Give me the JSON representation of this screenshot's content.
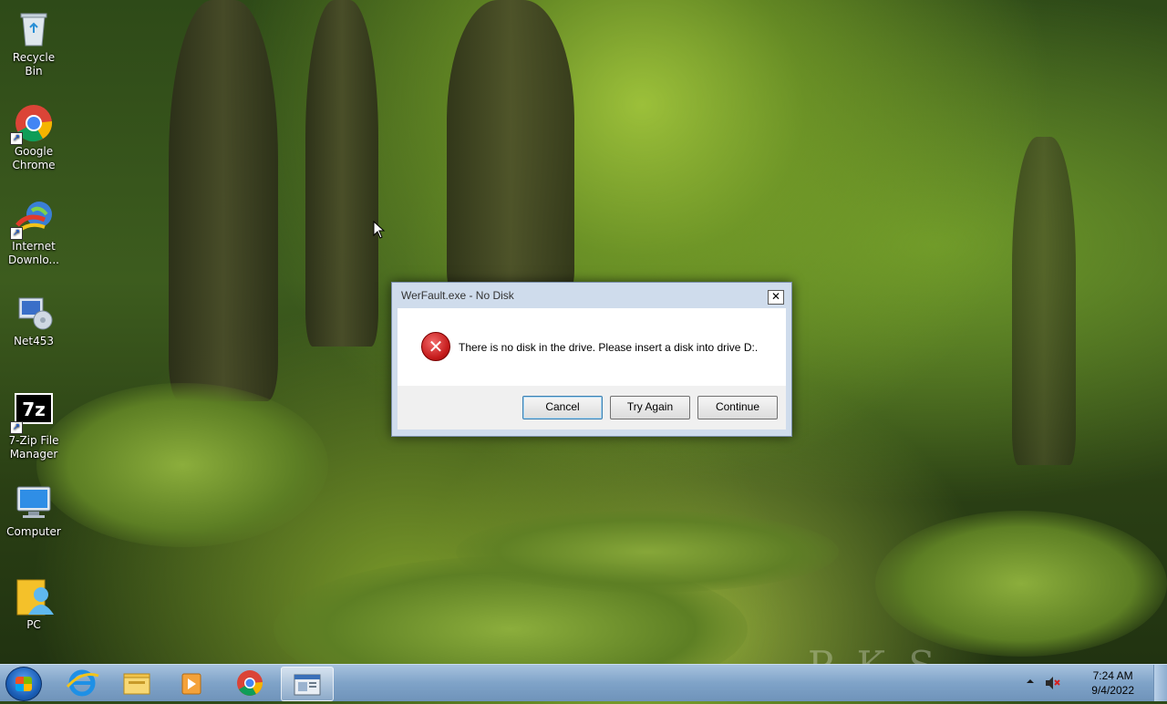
{
  "desktop": {
    "icons": [
      {
        "label": "Recycle Bin",
        "icon": "recycle-bin-icon"
      },
      {
        "label": "Google Chrome",
        "icon": "chrome-icon"
      },
      {
        "label": "Internet Downlo...",
        "icon": "internet-download-manager-icon"
      },
      {
        "label": "Net453",
        "icon": "net453-icon"
      },
      {
        "label": "7-Zip File Manager",
        "icon": "7zip-icon"
      },
      {
        "label": "Computer",
        "icon": "computer-icon"
      },
      {
        "label": "PC",
        "icon": "user-folder-icon"
      }
    ],
    "watermark": "P  K  S"
  },
  "dialog": {
    "title": "WerFault.exe - No Disk",
    "message": "There is no disk in the drive. Please insert a disk into drive D:.",
    "buttons": {
      "cancel": "Cancel",
      "try_again": "Try Again",
      "continue": "Continue"
    },
    "close_glyph": "✕"
  },
  "taskbar": {
    "pinned": [
      "internet-explorer-icon",
      "file-explorer-icon",
      "media-player-icon",
      "chrome-icon",
      "werfault-window-icon"
    ],
    "clock": {
      "time": "7:24 AM",
      "date": "9/4/2022"
    }
  }
}
